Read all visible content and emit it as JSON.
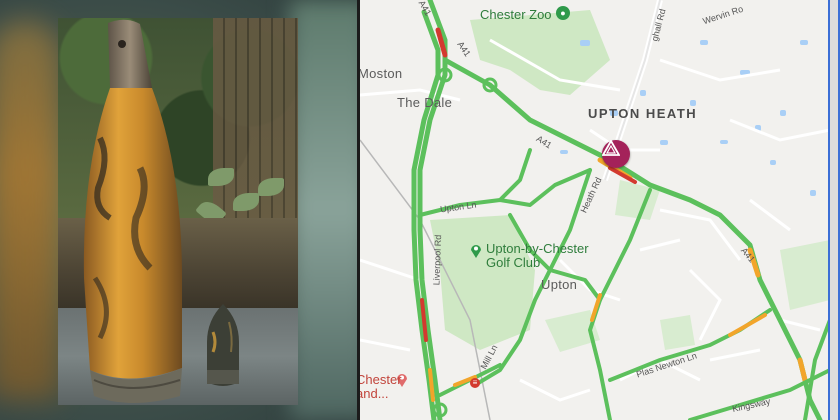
{
  "photo": {
    "description_icon": "unexploded-shell-photo"
  },
  "map": {
    "labels": {
      "chester_zoo": "Chester Zoo",
      "wervin_rd": "Wervin Ro",
      "moston": "Moston",
      "the_dale": "The Dale",
      "upton_heath": "UPTON HEATH",
      "upton": "Upton",
      "golf_club_line1": "Upton-by-Chester",
      "golf_club_line2": "Golf Club",
      "chester_line1": "Chester",
      "chester_line2": "and...",
      "a41_1": "A41",
      "a41_2": "A41",
      "a41_3": "A41",
      "a41_4": "A41",
      "upton_ln": "Upton Ln",
      "heath_rd": "Heath Rd",
      "liverpool_rd": "Liverpool Rd",
      "mill_ln": "Mill Ln",
      "plas_newton_ln": "Plas Newton Ln",
      "kingsway": "Kingsway",
      "hoole_rd_partial": "ghall Rd"
    },
    "colors": {
      "traffic_green": "#5cc05c",
      "traffic_orange": "#f2a52b",
      "traffic_red": "#d33a2f",
      "park": "#cfe8c4",
      "water": "#a9cff6",
      "incident": "#a4225a",
      "poi_green": "#2f7d3c"
    },
    "icons": [
      "zoo-paw-icon",
      "incident-warning-icon",
      "golf-club-pin-icon",
      "place-pin-icon",
      "rail-station-icon",
      "road-junction-icon"
    ]
  }
}
